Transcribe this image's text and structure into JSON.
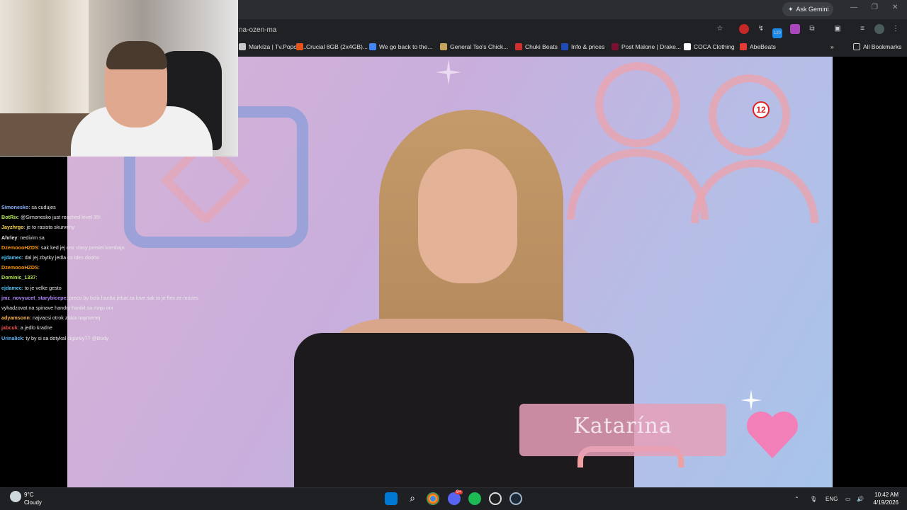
{
  "browser": {
    "ask_label": "Ask Gemini",
    "url": "na-ozen-ma",
    "extension_badge": "120",
    "bookmarks": [
      {
        "label": "Markíza | Tv.Popcor...",
        "color": "#c9c9c9"
      },
      {
        "label": "Crucial 8GB (2x4GB)...",
        "color": "#e8541a"
      },
      {
        "label": "We go back to the...",
        "color": "#4285f4"
      },
      {
        "label": "General Tso's Chick...",
        "color": "#c6a35a"
      },
      {
        "label": "Chuki Beats",
        "color": "#d32f2f"
      },
      {
        "label": "Info & prices",
        "color": "#1e4bb8"
      },
      {
        "label": "Post Malone | Drake...",
        "color": "#7a1030"
      },
      {
        "label": "COCA Clothing",
        "color": "#ffffff"
      },
      {
        "label": "AbeBeats",
        "color": "#e53935"
      }
    ],
    "all_bookmarks": "All Bookmarks"
  },
  "video": {
    "name_tag": "Katarína",
    "channel_logo": "12"
  },
  "chat": [
    {
      "user": "Simonesko",
      "color": "#8ab4f8",
      "text": ": sa cudujes"
    },
    {
      "user": "BotRix",
      "color": "#b5e853",
      "text": ": @Simonesko just reached level 35!"
    },
    {
      "user": "Jayzhrgo",
      "color": "#ffd54f",
      "text": ": je to rasista skurveny"
    },
    {
      "user": "Ahrley",
      "color": "#e8e8e8",
      "text": ": nedivim sa"
    },
    {
      "user": "DzemoooHZDS",
      "color": "#ff9800",
      "text": ": sak ked jej cez vlasy presiel kombajn"
    },
    {
      "user": "ejdamec",
      "color": "#4fc3f7",
      "text": ": dal jej zbytky jedla co ides dooho"
    },
    {
      "user": "DzemoooHZDS",
      "color": "#ff9800",
      "text": ":"
    },
    {
      "user": "Dominic_1337",
      "color": "#b5e853",
      "text": ":"
    },
    {
      "user": "ejdamec",
      "color": "#4fc3f7",
      "text": ": to je velke gesto"
    },
    {
      "user": "jmz_novyucet_starybicepe",
      "color": "#b388ff",
      "text": ": preco by bola hanba jebat za love sak to je flex ze mozes"
    },
    {
      "user": "",
      "color": "#e8e8e8",
      "text": "vyhadzovat na spinave handry hanbit sa maju oni"
    },
    {
      "user": "adyamsonn",
      "color": "#ffb74d",
      "text": ": najvacsi otrok ziska naymenej"
    },
    {
      "user": "jabcuk",
      "color": "#ef5350",
      "text": ": a jedlo kradne"
    },
    {
      "user": "Urinalick",
      "color": "#64b5f6",
      "text": ": ty by si sa dotykal ciganky?? @Body"
    }
  ],
  "taskbar": {
    "temperature": "9°C",
    "weather": "Cloudy",
    "language": "ENG",
    "time": "10:42 AM",
    "date": "4/19/2026",
    "discord_badge": "9+"
  }
}
